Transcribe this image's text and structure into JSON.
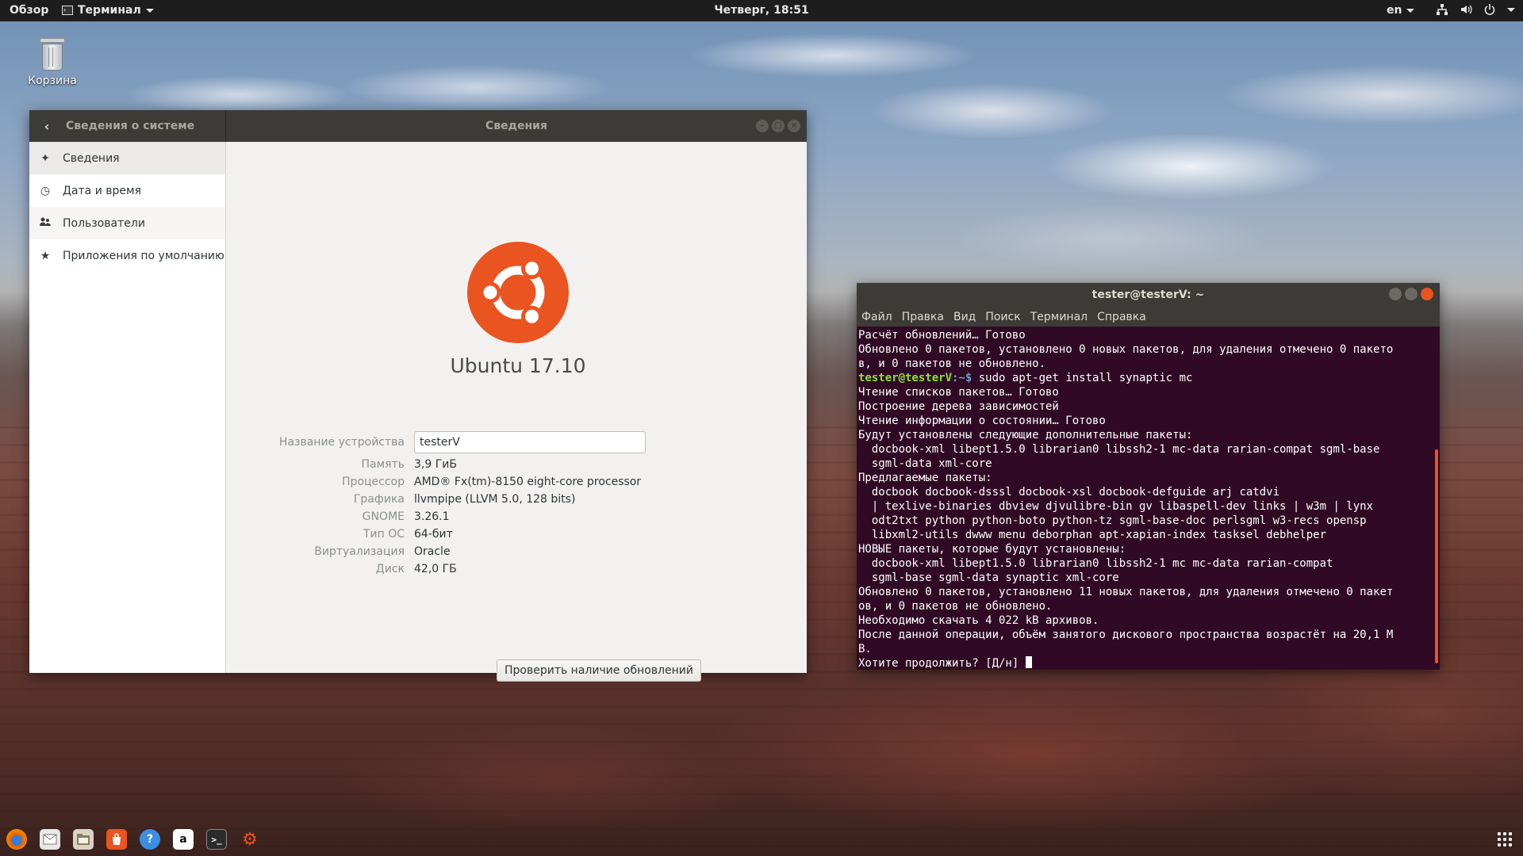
{
  "topbar": {
    "overview": "Обзор",
    "app_menu": "Терминал",
    "clock": "Четверг, 18:51",
    "lang": "en",
    "tray_icons": [
      "network-icon",
      "volume-icon",
      "power-icon"
    ]
  },
  "desktop": {
    "trash_label": "Корзина"
  },
  "settings": {
    "left_title": "Сведения о системе",
    "center_title": "Сведения",
    "sidebar": [
      {
        "icon": "sparkle-icon",
        "label": "Сведения"
      },
      {
        "icon": "clock-icon",
        "label": "Дата и время"
      },
      {
        "icon": "users-icon",
        "label": "Пользователи"
      },
      {
        "icon": "star-icon",
        "label": "Приложения по умолчанию"
      }
    ],
    "os_name": "Ubuntu 17.10",
    "device_label": "Название устройства",
    "device_value": "testerV",
    "details": [
      {
        "k": "Память",
        "v": "3,9 ГиБ"
      },
      {
        "k": "Процессор",
        "v": "AMD® Fx(tm)-8150 eight-core processor"
      },
      {
        "k": "Графика",
        "v": "llvmpipe (LLVM 5.0, 128 bits)"
      },
      {
        "k": "GNOME",
        "v": "3.26.1"
      },
      {
        "k": "Тип ОС",
        "v": "64-бит"
      },
      {
        "k": "Виртуализация",
        "v": "Oracle"
      },
      {
        "k": "Диск",
        "v": "42,0 ГБ"
      }
    ],
    "check_updates": "Проверить наличие обновлений",
    "colors": {
      "accent": "#e95420"
    }
  },
  "terminal": {
    "title": "tester@testerV: ~",
    "menu": [
      "Файл",
      "Правка",
      "Вид",
      "Поиск",
      "Терминал",
      "Справка"
    ],
    "lines_before": [
      "Расчёт обновлений… Готово",
      "Обновлено 0 пакетов, установлено 0 новых пакетов, для удаления отмечено 0 пакето",
      "в, и 0 пакетов не обновлено."
    ],
    "prompt_user": "tester@testerV",
    "prompt_path": ":~$",
    "command": " sudo apt-get install synaptic mc",
    "lines_after": [
      "Чтение списков пакетов… Готово",
      "Построение дерева зависимостей",
      "Чтение информации о состоянии… Готово",
      "Будут установлены следующие дополнительные пакеты:",
      "  docbook-xml libept1.5.0 librarian0 libssh2-1 mc-data rarian-compat sgml-base",
      "  sgml-data xml-core",
      "Предлагаемые пакеты:",
      "  docbook docbook-dsssl docbook-xsl docbook-defguide arj catdvi",
      "  | texlive-binaries dbview djvulibre-bin gv libaspell-dev links | w3m | lynx",
      "  odt2txt python python-boto python-tz sgml-base-doc perlsgml w3-recs opensp",
      "  libxml2-utils dwww menu deborphan apt-xapian-index tasksel debhelper",
      "НОВЫЕ пакеты, которые будут установлены:",
      "  docbook-xml libept1.5.0 librarian0 libssh2-1 mc mc-data rarian-compat",
      "  sgml-base sgml-data synaptic xml-core",
      "Обновлено 0 пакетов, установлено 11 новых пакетов, для удаления отмечено 0 пакет",
      "ов, и 0 пакетов не обновлено.",
      "Необходимо скачать 4 022 kB архивов.",
      "После данной операции, объём занятого дискового пространства возрастёт на 20,1 M",
      "B.",
      "Хотите продолжить? [Д/н]"
    ]
  },
  "dock": {
    "items": [
      {
        "name": "firefox-icon",
        "glyph": "",
        "color": "#e66000"
      },
      {
        "name": "thunderbird-icon",
        "glyph": "",
        "color": "#dcdcdc"
      },
      {
        "name": "files-icon",
        "glyph": "",
        "color": "#b08a5a"
      },
      {
        "name": "software-icon",
        "glyph": "",
        "color": "#e95420"
      },
      {
        "name": "help-icon",
        "glyph": "?",
        "color": "#3c8ee0"
      },
      {
        "name": "amazon-icon",
        "glyph": "a",
        "color": "#ffffff"
      },
      {
        "name": "terminal-icon",
        "glyph": ">_",
        "color": "#2c2c2c"
      },
      {
        "name": "settings-icon",
        "glyph": "⚙",
        "color": "#e95420"
      }
    ]
  }
}
